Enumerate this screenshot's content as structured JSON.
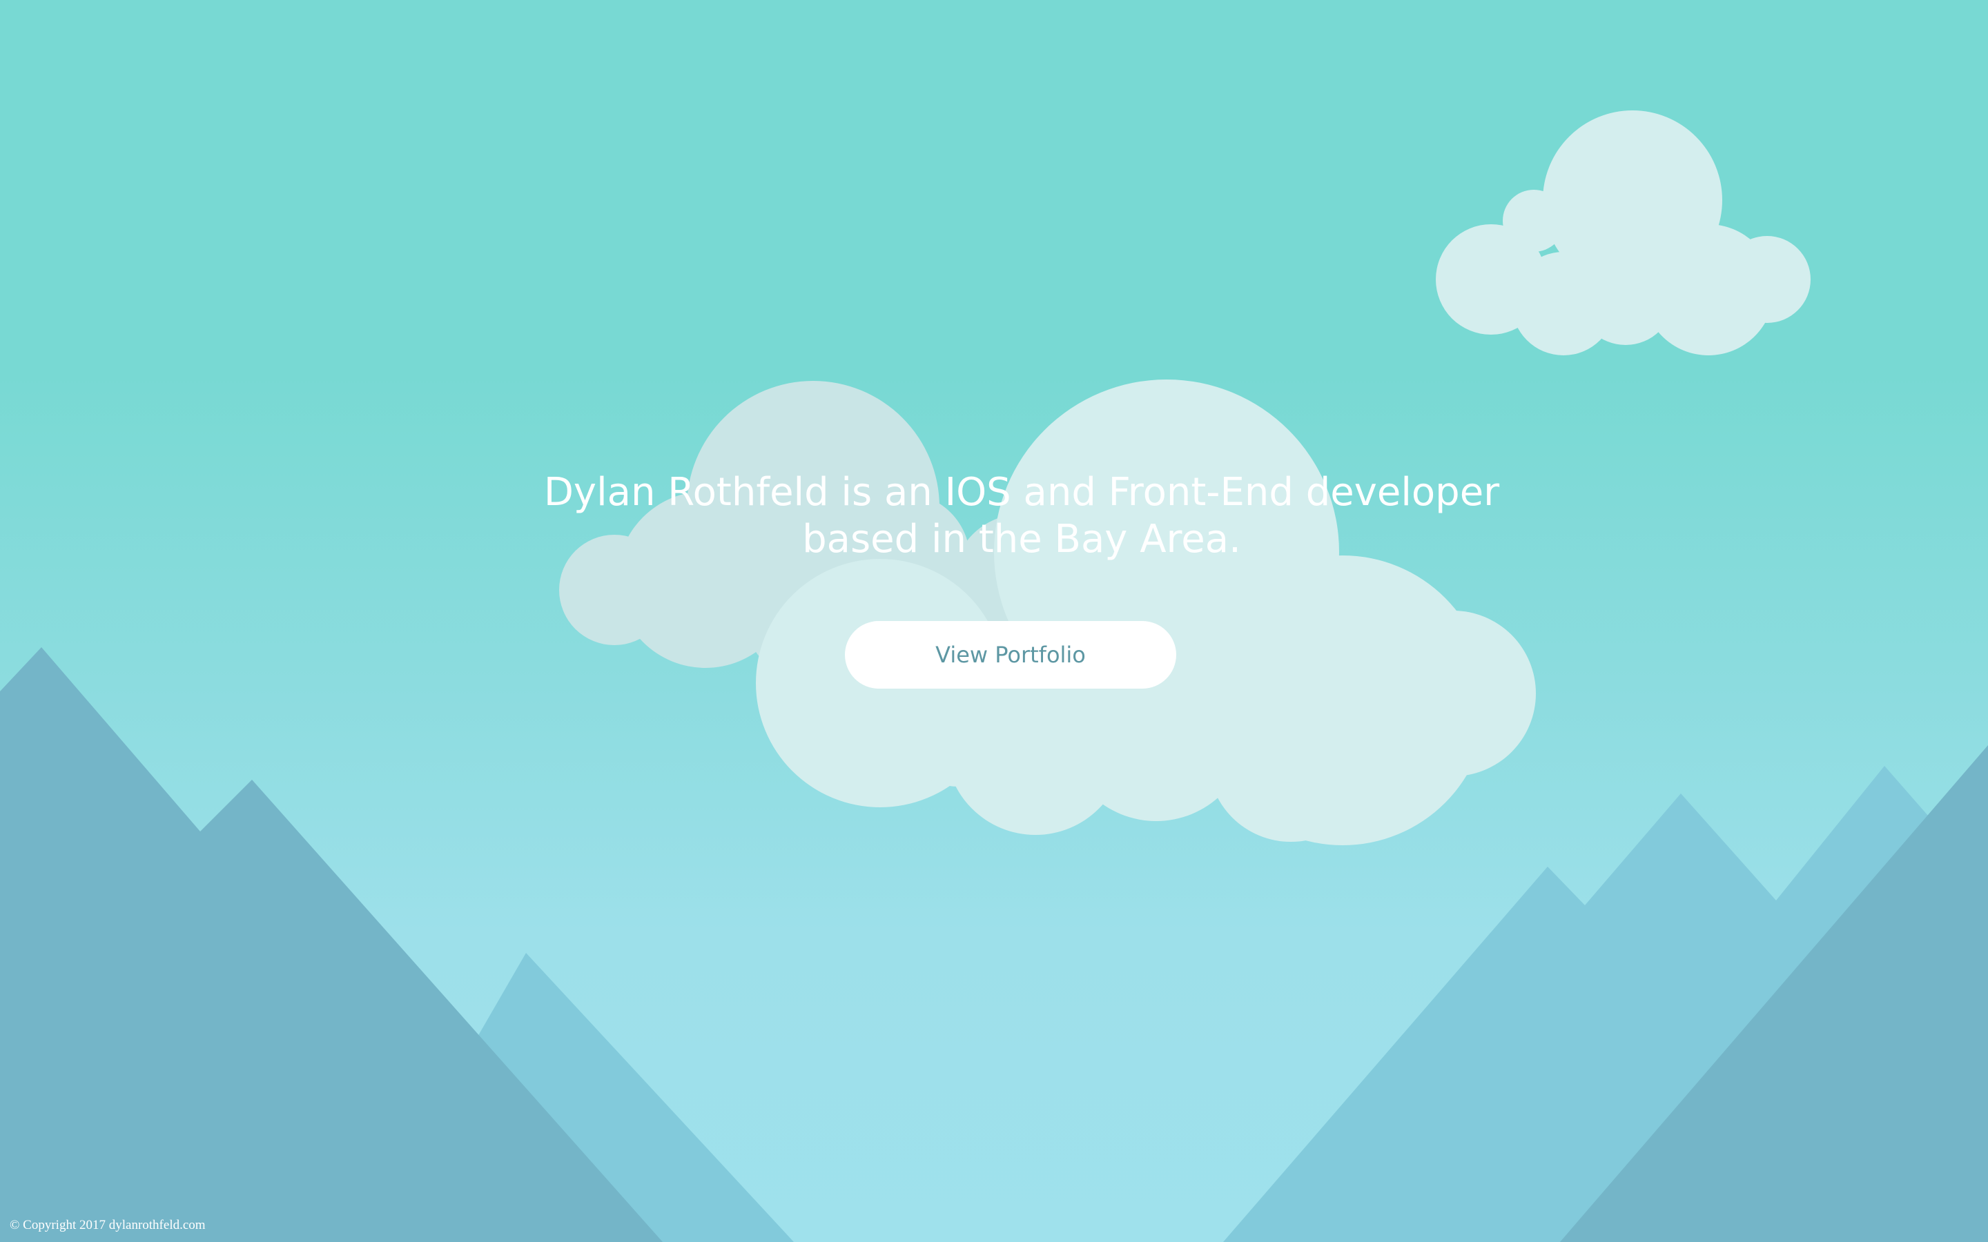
{
  "hero": {
    "headline": "Dylan Rothfeld is an IOS and Front-End developer based in the Bay Area.",
    "cta_label": "View Portfolio"
  },
  "footer": {
    "copyright": "© Copyright 2017 dylanrothfeld.com"
  },
  "colors": {
    "sky_top": "#78d9d3",
    "sky_bottom": "#9fe1ec",
    "cloud": "#d4eeee",
    "mountain_back": "#82cadb",
    "mountain_front": "#74b5c8",
    "button_bg": "#ffffff",
    "button_text": "#5d97a3"
  }
}
